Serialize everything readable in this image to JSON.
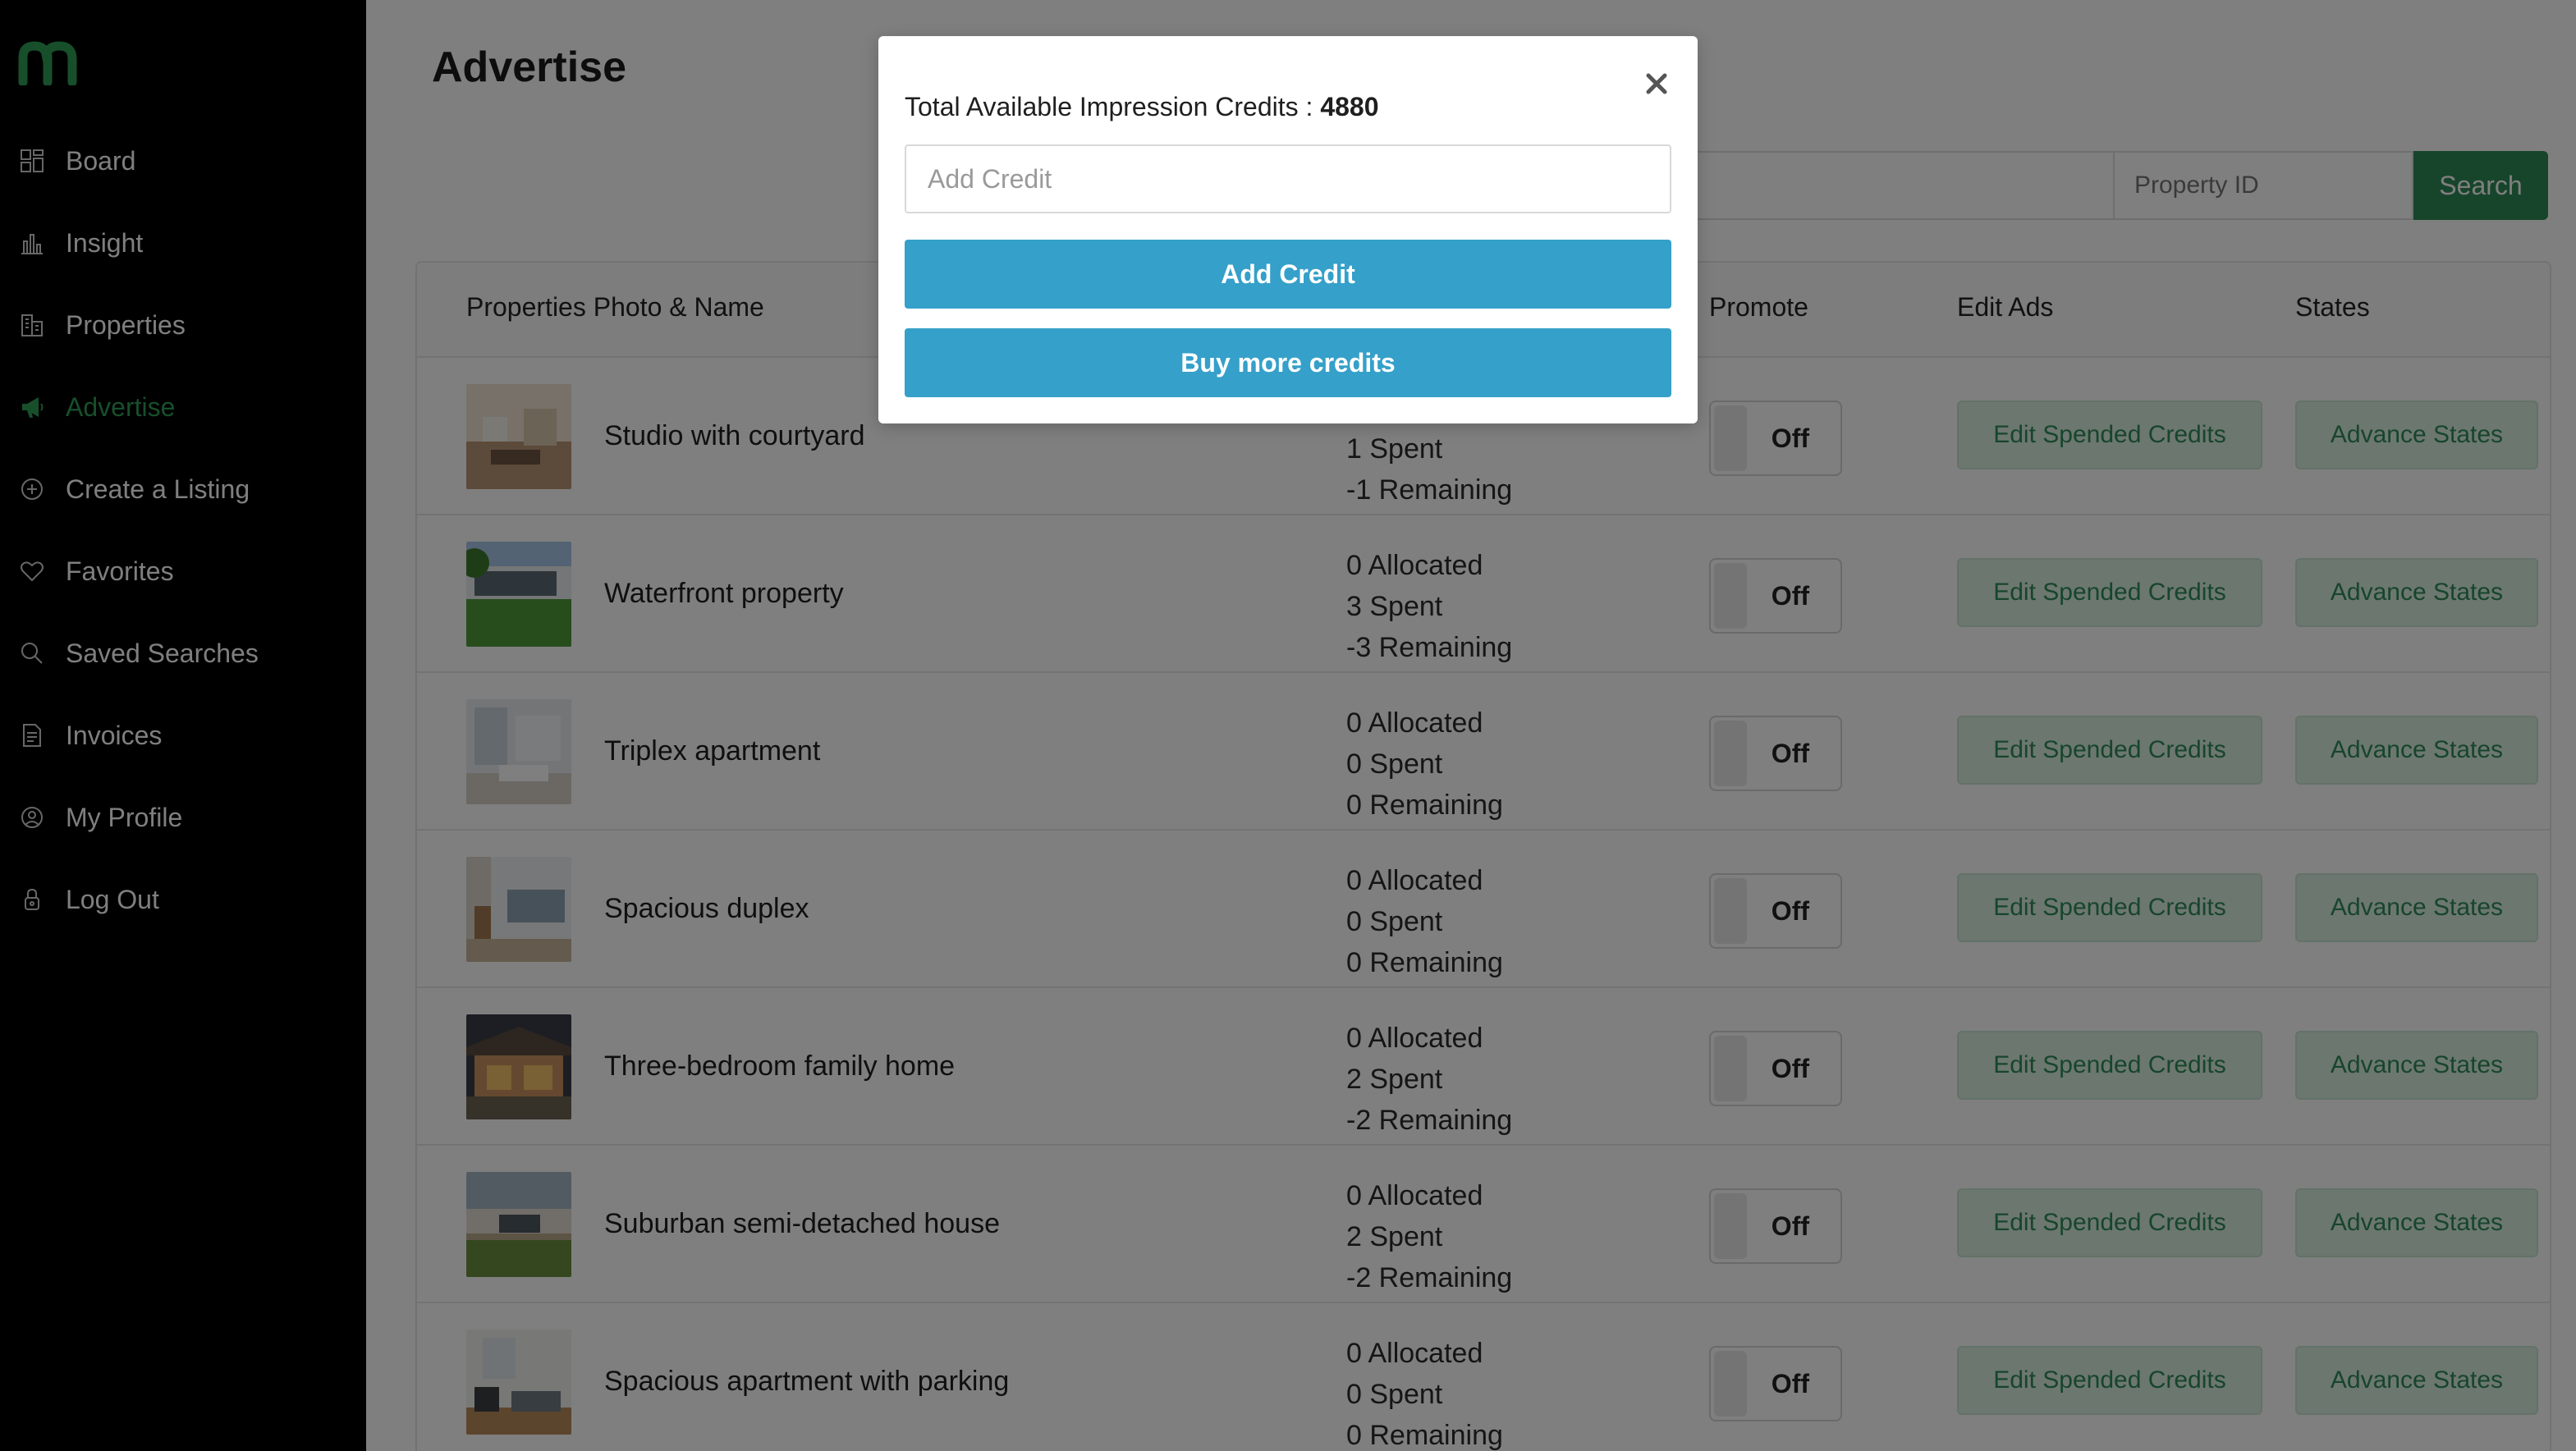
{
  "sidebar": {
    "logo": "m",
    "items": [
      {
        "label": "Board",
        "icon": "board-icon",
        "active": false
      },
      {
        "label": "Insight",
        "icon": "chart-icon",
        "active": false
      },
      {
        "label": "Properties",
        "icon": "building-icon",
        "active": false
      },
      {
        "label": "Advertise",
        "icon": "megaphone-icon",
        "active": true
      },
      {
        "label": "Create a Listing",
        "icon": "plus-circle-icon",
        "active": false
      },
      {
        "label": "Favorites",
        "icon": "heart-icon",
        "active": false
      },
      {
        "label": "Saved Searches",
        "icon": "search-icon",
        "active": false
      },
      {
        "label": "Invoices",
        "icon": "invoice-icon",
        "active": false
      },
      {
        "label": "My Profile",
        "icon": "profile-icon",
        "active": false
      },
      {
        "label": "Log Out",
        "icon": "lock-icon",
        "active": false
      }
    ]
  },
  "page": {
    "title": "Advertise"
  },
  "search": {
    "property_id_placeholder": "Property ID",
    "button_label": "Search"
  },
  "table": {
    "headers": {
      "photo_name": "Properties Photo & Name",
      "promote": "Promote",
      "edit_ads": "Edit Ads",
      "states": "States"
    },
    "rows": [
      {
        "name": "Studio with courtyard",
        "allocated": "",
        "spent": "1 Spent",
        "remaining": "-1 Remaining",
        "promote": "Off",
        "edit_label": "Edit Spended Credits",
        "states_label": "Advance States"
      },
      {
        "name": "Waterfront property",
        "allocated": "0 Allocated",
        "spent": "3 Spent",
        "remaining": "-3 Remaining",
        "promote": "Off",
        "edit_label": "Edit Spended Credits",
        "states_label": "Advance States"
      },
      {
        "name": "Triplex apartment",
        "allocated": "0 Allocated",
        "spent": "0 Spent",
        "remaining": "0 Remaining",
        "promote": "Off",
        "edit_label": "Edit Spended Credits",
        "states_label": "Advance States"
      },
      {
        "name": "Spacious duplex",
        "allocated": "0 Allocated",
        "spent": "0 Spent",
        "remaining": "0 Remaining",
        "promote": "Off",
        "edit_label": "Edit Spended Credits",
        "states_label": "Advance States"
      },
      {
        "name": "Three-bedroom family home",
        "allocated": "0 Allocated",
        "spent": "2 Spent",
        "remaining": "-2 Remaining",
        "promote": "Off",
        "edit_label": "Edit Spended Credits",
        "states_label": "Advance States"
      },
      {
        "name": "Suburban semi-detached house",
        "allocated": "0 Allocated",
        "spent": "2 Spent",
        "remaining": "-2 Remaining",
        "promote": "Off",
        "edit_label": "Edit Spended Credits",
        "states_label": "Advance States"
      },
      {
        "name": "Spacious apartment with parking",
        "allocated": "0 Allocated",
        "spent": "0 Spent",
        "remaining": "0 Remaining",
        "promote": "Off",
        "edit_label": "Edit Spended Credits",
        "states_label": "Advance States"
      }
    ]
  },
  "modal": {
    "title_prefix": "Total Available Impression Credits : ",
    "total_credits": "4880",
    "input_placeholder": "Add Credit",
    "add_button_label": "Add Credit",
    "buy_button_label": "Buy more credits",
    "close_icon": "close-icon"
  },
  "colors": {
    "sidebar_bg": "#000000",
    "accent_green": "#2e8b57",
    "active_nav": "#2f9e57",
    "modal_button": "#35a0c9",
    "overlay": "rgba(0,0,0,0.5)"
  }
}
